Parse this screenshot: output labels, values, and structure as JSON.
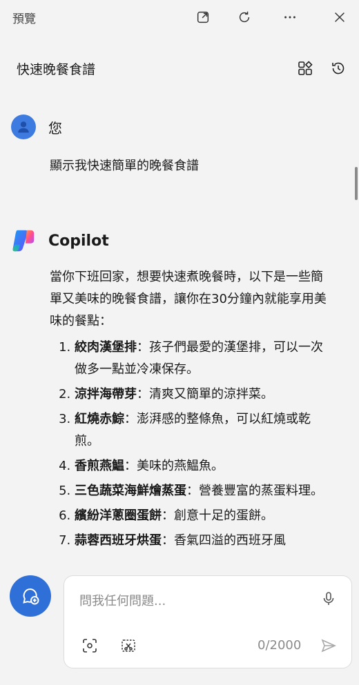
{
  "topbar": {
    "title": "預覽",
    "icons": [
      "open-external-icon",
      "refresh-icon",
      "more-icon",
      "close-icon"
    ]
  },
  "conversation": {
    "title": "快速晚餐食譜",
    "icons": [
      "new-chat-grid-icon",
      "history-icon"
    ]
  },
  "user_message": {
    "sender": "您",
    "text": "顯示我快速簡單的晚餐食譜"
  },
  "copilot_message": {
    "sender": "Copilot",
    "intro": "當你下班回家，想要快速煮晚餐時，以下是一些簡單又美味的晚餐食譜，讓你在30分鐘內就能享用美味的餐點：",
    "items": [
      {
        "name": "絞肉漢堡排",
        "desc": "：孩子們最愛的漢堡排，可以一次做多一點並冷凍保存。"
      },
      {
        "name": "涼拌海帶芽",
        "desc": "：清爽又簡單的涼拌菜。"
      },
      {
        "name": "紅燒赤鯮",
        "desc": "：澎湃感的整條魚，可以紅燒或乾煎。"
      },
      {
        "name": "香煎燕鰛",
        "desc": "：美味的燕鰛魚。"
      },
      {
        "name": "三色蔬菜海鮮燴蒸蛋",
        "desc": "：營養豐富的蒸蛋料理。"
      },
      {
        "name": "繽紛洋蔥圈蛋餅",
        "desc": "：創意十足的蛋餅。"
      },
      {
        "name": "蒜蓉西班牙烘蛋",
        "desc": "：香氣四溢的西班牙風"
      }
    ]
  },
  "composer": {
    "placeholder": "問我任何問題...",
    "counter": "0/2000"
  },
  "colors": {
    "accent": "#2f6fd8",
    "avatar": "#3d7be0",
    "background": "#f3f3f3"
  }
}
